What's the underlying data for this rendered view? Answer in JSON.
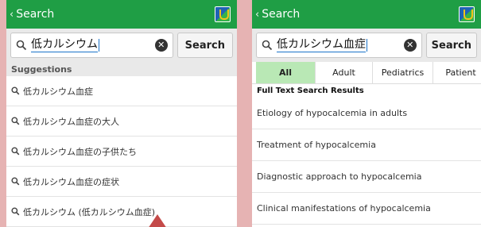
{
  "left": {
    "header": {
      "back_label": "Search"
    },
    "search": {
      "query": "低カルシウム",
      "button_label": "Search"
    },
    "suggestions": {
      "heading": "Suggestions",
      "items": [
        {
          "label": "低カルシウム血症"
        },
        {
          "label": "低カルシウム血症の大人"
        },
        {
          "label": "低カルシウム血症の子供たち"
        },
        {
          "label": "低カルシウム血症の症状"
        },
        {
          "label": "低カルシウム (低カルシウム血症)"
        }
      ]
    }
  },
  "right": {
    "header": {
      "back_label": "Search"
    },
    "search": {
      "query": "低カルシウム血症",
      "button_label": "Search"
    },
    "tabs": [
      {
        "label": "All",
        "active": true
      },
      {
        "label": "Adult"
      },
      {
        "label": "Pediatrics"
      },
      {
        "label": "Patient"
      }
    ],
    "results": {
      "heading": "Full Text Search Results",
      "items": [
        {
          "title": "Etiology of hypocalcemia in adults"
        },
        {
          "title": "Treatment of hypocalcemia"
        },
        {
          "title": "Diagnostic approach to hypocalcemia"
        },
        {
          "title": "Clinical manifestations of hypocalcemia"
        }
      ]
    }
  },
  "colors": {
    "header_green": "#1f9e45",
    "active_tab": "#b9e8b5",
    "background_pink": "#e6b3b3",
    "pointer": "#c44a49"
  },
  "icons": {
    "back": "chevron-left-icon",
    "search": "magnifier-icon",
    "clear": "clear-x-icon",
    "logo": "app-logo-icon",
    "result_arrow": "chevron-right-icon"
  }
}
